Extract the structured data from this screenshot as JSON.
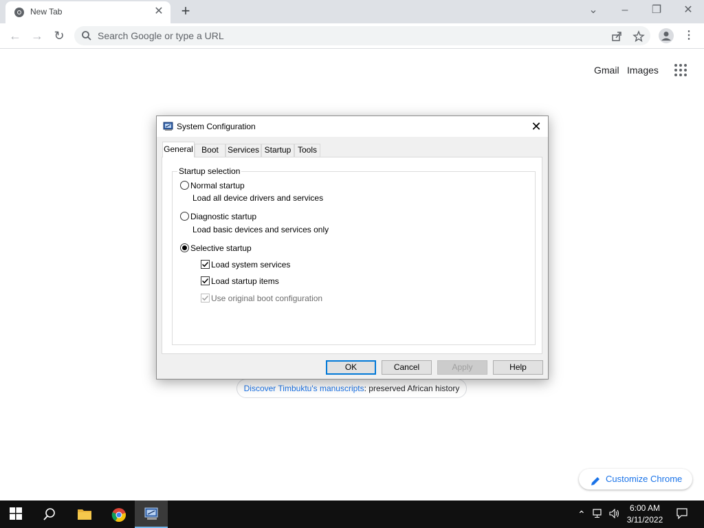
{
  "browser": {
    "tab_title": "New Tab",
    "omnibox_placeholder": "Search Google or type a URL"
  },
  "ntp": {
    "gmail": "Gmail",
    "images": "Images",
    "promo_link": "Discover Timbuktu's manuscripts",
    "promo_rest": ": preserved African history",
    "customize": "Customize Chrome"
  },
  "dialog": {
    "title": "System Configuration",
    "tabs": [
      "General",
      "Boot",
      "Services",
      "Startup",
      "Tools"
    ],
    "group_label": "Startup selection",
    "normal": {
      "label": "Normal startup",
      "desc": "Load all device drivers and services",
      "selected": false
    },
    "diagnostic": {
      "label": "Diagnostic startup",
      "desc": "Load basic devices and services only",
      "selected": false
    },
    "selective": {
      "label": "Selective startup",
      "selected": true
    },
    "options": [
      {
        "label": "Load system services",
        "checked": true,
        "enabled": true
      },
      {
        "label": "Load startup items",
        "checked": true,
        "enabled": true
      },
      {
        "label": "Use original boot configuration",
        "checked": true,
        "enabled": false
      }
    ],
    "buttons": {
      "ok": "OK",
      "cancel": "Cancel",
      "apply": "Apply",
      "help": "Help"
    }
  },
  "taskbar": {
    "time": "6:00 AM",
    "date": "3/11/2022"
  },
  "colors": {
    "accent": "#1a73e8",
    "taskbar": "#101010",
    "dialog_bg": "#f0f0f0"
  }
}
